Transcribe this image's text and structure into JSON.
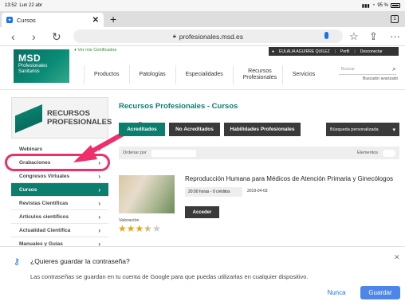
{
  "status": {
    "time": "13:52",
    "date": "Lun 22 abr",
    "battery": "95 %"
  },
  "tabs": {
    "title": "Cursos",
    "close": "✕",
    "new": "+",
    "count": "1"
  },
  "toolbar": {
    "back": "‹",
    "forward": "›",
    "reload": "↻",
    "url": "profesionales.msd.es",
    "bookmark": "☆",
    "share": "⇪",
    "menu": "···"
  },
  "header": {
    "logo_main": "MSD",
    "logo_sub1": "Profesionales",
    "logo_sub2": "Sanitarios",
    "certificates": "Ver mis Certificados",
    "user": "EULALIA AGUIRRE QUILEZ",
    "profile": "Perfil",
    "logout": "Desconectar",
    "nav": [
      "Productos",
      "Patologías",
      "Especialidades",
      "Recursos Profesionales",
      "Servicios"
    ],
    "search_placeholder": "Buscar",
    "advanced": "Buscador avanzado"
  },
  "sidebar": {
    "logo_line1": "RECURSOS",
    "logo_line2": "PROFESIONALES",
    "items": [
      {
        "label": "Webinars",
        "active": false
      },
      {
        "label": "Grabaciones",
        "active": false
      },
      {
        "label": "Congresos Virtuales",
        "active": false
      },
      {
        "label": "Cursos",
        "active": true
      },
      {
        "label": "Revistas Científicas",
        "active": false
      },
      {
        "label": "Artículos científicos",
        "active": false
      },
      {
        "label": "Actualidad Científica",
        "active": false
      },
      {
        "label": "Manuales y Guías",
        "active": false
      }
    ]
  },
  "main": {
    "title": "Recursos Profesionales - Cursos",
    "filters": [
      "Acreditados",
      "No Acreditados",
      "Habilidades Profesionales"
    ],
    "custom_search": "Búsqueda personalizada",
    "sort_label": "Ordenar por",
    "elements_label": "Elementos",
    "course": {
      "title": "Reproducción Humana para Médicos de Atención Primaria y Ginecólogos",
      "hours": "20:00 horas - 0 créditos",
      "date": "2019-04-03",
      "button": "Acceder",
      "rating_label": "Valoración",
      "rating": 3.5,
      "rating_max": 5
    }
  },
  "password_prompt": {
    "question": "¿Quieres guardar la contraseña?",
    "message": "Las contraseñas se guardan en tu cuenta de Google para que puedas utilizarlas en cualquier dispositivo.",
    "never": "Nunca",
    "save": "Guardar"
  },
  "colors": {
    "brand": "#0a7f6e",
    "highlight": "#ef2f6a",
    "link": "#1a73e8"
  }
}
